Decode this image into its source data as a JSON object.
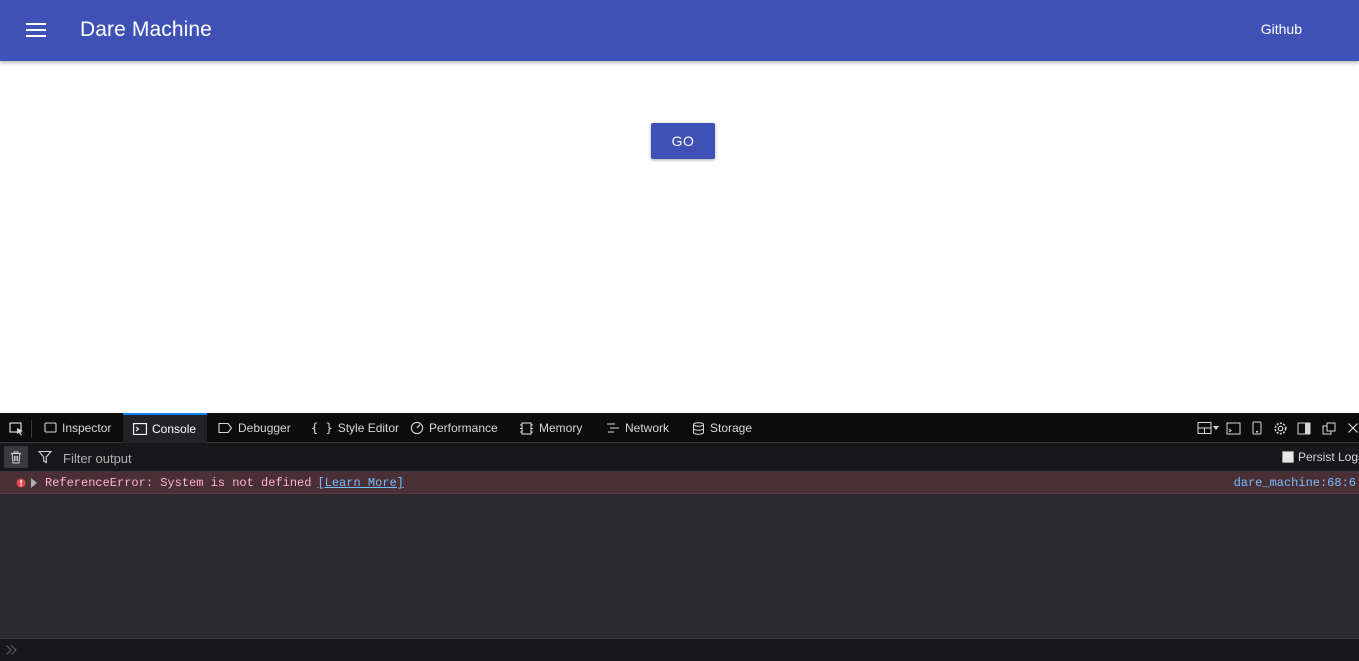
{
  "appbar": {
    "title": "Dare Machine",
    "github_label": "Github",
    "color": "#3f51b5"
  },
  "content": {
    "go_label": "GO"
  },
  "devtools": {
    "tabs": [
      {
        "label": "Inspector",
        "icon": "inspector-icon",
        "selected": false
      },
      {
        "label": "Console",
        "icon": "console-icon",
        "selected": true
      },
      {
        "label": "Debugger",
        "icon": "debugger-icon",
        "selected": false
      },
      {
        "label": "Style Editor",
        "icon": "style-editor-icon",
        "selected": false
      },
      {
        "label": "Performance",
        "icon": "performance-icon",
        "selected": false
      },
      {
        "label": "Memory",
        "icon": "memory-icon",
        "selected": false
      },
      {
        "label": "Network",
        "icon": "network-icon",
        "selected": false
      },
      {
        "label": "Storage",
        "icon": "storage-icon",
        "selected": false
      }
    ],
    "toolbar": {
      "filter_placeholder": "Filter output",
      "persist_logs_label": "Persist Logs"
    },
    "messages": [
      {
        "level": "error",
        "text": "ReferenceError: System is not defined",
        "learn_more": "[Learn More]",
        "source_file": "dare_machine",
        "source_line": ":68:6"
      }
    ]
  }
}
